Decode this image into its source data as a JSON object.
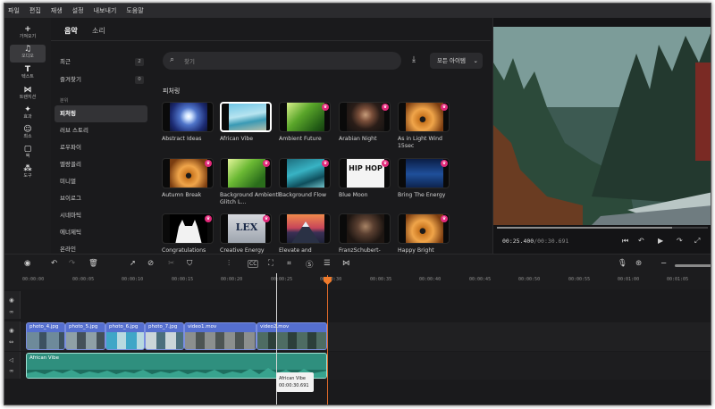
{
  "menu": [
    "파일",
    "편집",
    "재생",
    "설정",
    "내보내기",
    "도움말"
  ],
  "rail": [
    {
      "icon": "+",
      "label": "가져오기"
    },
    {
      "icon": "♫",
      "label": "오디오"
    },
    {
      "icon": "T",
      "label": "텍스트"
    },
    {
      "icon": "⋈",
      "label": "트랜지션"
    },
    {
      "icon": "✦",
      "label": "효과"
    },
    {
      "icon": "☺",
      "label": "최소"
    },
    {
      "icon": "▢",
      "label": "팩"
    },
    {
      "icon": "⁂",
      "label": "도구"
    }
  ],
  "library": {
    "tabs": [
      "음악",
      "소리"
    ],
    "categories_top": [
      {
        "label": "최근",
        "count": "2"
      },
      {
        "label": "즐겨찾기",
        "count": "0"
      }
    ],
    "group_header": "분위",
    "categories": [
      "피처링",
      "러브 스토리",
      "로우파이",
      "멜랑꼴리",
      "미니멀",
      "브이로그",
      "시네마틱",
      "에너제틱",
      "온라인"
    ],
    "search_placeholder": "찾기",
    "all_items_label": "모든 아이템",
    "featured_title": "피처링",
    "tracks": [
      "Abstract Ideas",
      "African Vibe",
      "Ambient Future",
      "Arabian Night",
      "As in Light Wind 15sec",
      "Autumn Break",
      "Background Ambientl Glitch L...",
      "Background Flow",
      "Blue Moon",
      "Bring The Energy",
      "Congratulations",
      "Creative Energy",
      "Elevate and",
      "FranzSchubert-",
      "Happy Bright"
    ],
    "thumb_text": {
      "lex": "LEX",
      "hiphop": "HIP HOP"
    }
  },
  "preview": {
    "current_time": "00:25.400",
    "total_time": "/00:30.691",
    "progress_fraction": 0.83
  },
  "timeline": {
    "ruler_ticks": [
      "00:00:00",
      "00:00:05",
      "00:00:10",
      "00:00:15",
      "00:00:20",
      "00:00:25",
      "00:00:30",
      "00:00:35",
      "00:00:40",
      "00:00:45",
      "00:00:50",
      "00:00:55",
      "00:01:00",
      "00:01:05"
    ],
    "video_clips": [
      "photo_4.jpg",
      "photo_5.jpg",
      "photo_6.jpg",
      "photo_7.jpg",
      "video1.mov",
      "video2.mov"
    ],
    "audio_clip": "African Vibe",
    "tooltip_name": "African Vibe",
    "tooltip_time": "00:00:30.691"
  },
  "colors": {
    "accent": "#e2297a",
    "playhead": "#e06a2a",
    "video_clip": "#556fcf",
    "audio_clip": "#2f8f7e"
  }
}
